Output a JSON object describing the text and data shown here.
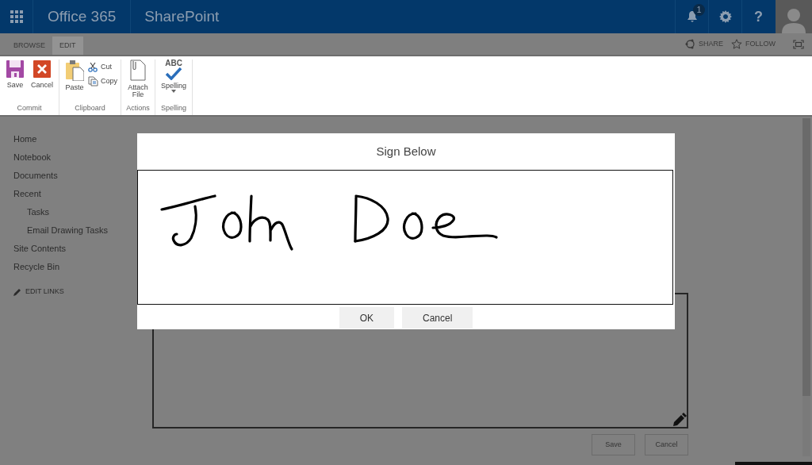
{
  "app_bar": {
    "app_name": "Office 365",
    "site_name": "SharePoint",
    "notification_count": "1",
    "help_label": "?"
  },
  "ribbon_tabs": [
    {
      "label": "BROWSE",
      "selected": false
    },
    {
      "label": "EDIT",
      "selected": true
    }
  ],
  "page_actions": [
    {
      "kind": "share",
      "label": "SHARE"
    },
    {
      "kind": "follow",
      "label": "FOLLOW"
    },
    {
      "kind": "focus"
    }
  ],
  "ribbon_groups": [
    {
      "label": "Commit",
      "commands": [
        {
          "kind": "save",
          "label": "Save"
        },
        {
          "kind": "cancel",
          "label": "Cancel"
        }
      ]
    },
    {
      "label": "Clipboard",
      "commands": [
        {
          "kind": "paste",
          "label": "Paste"
        },
        {
          "kind": "cut",
          "label": "Cut"
        },
        {
          "kind": "copy",
          "label": "Copy"
        }
      ]
    },
    {
      "label": "Actions",
      "commands": [
        {
          "kind": "attach",
          "label": "Attach File"
        }
      ]
    },
    {
      "label": "Spelling",
      "commands": [
        {
          "kind": "spelling",
          "label": "Spelling",
          "icon_text": "ABC"
        }
      ]
    }
  ],
  "nav": [
    {
      "label": "Home"
    },
    {
      "label": "Notebook"
    },
    {
      "label": "Documents"
    },
    {
      "label": "Recent",
      "children": [
        {
          "label": "Tasks"
        },
        {
          "label": "Email Drawing Tasks"
        }
      ]
    },
    {
      "label": "Site Contents"
    },
    {
      "label": "Recycle Bin"
    }
  ],
  "edit_links": "EDIT LINKS",
  "form_buttons": [
    "Save",
    "Cancel"
  ],
  "dialog": {
    "title": "Sign Below",
    "buttons": [
      "OK",
      "Cancel"
    ]
  }
}
